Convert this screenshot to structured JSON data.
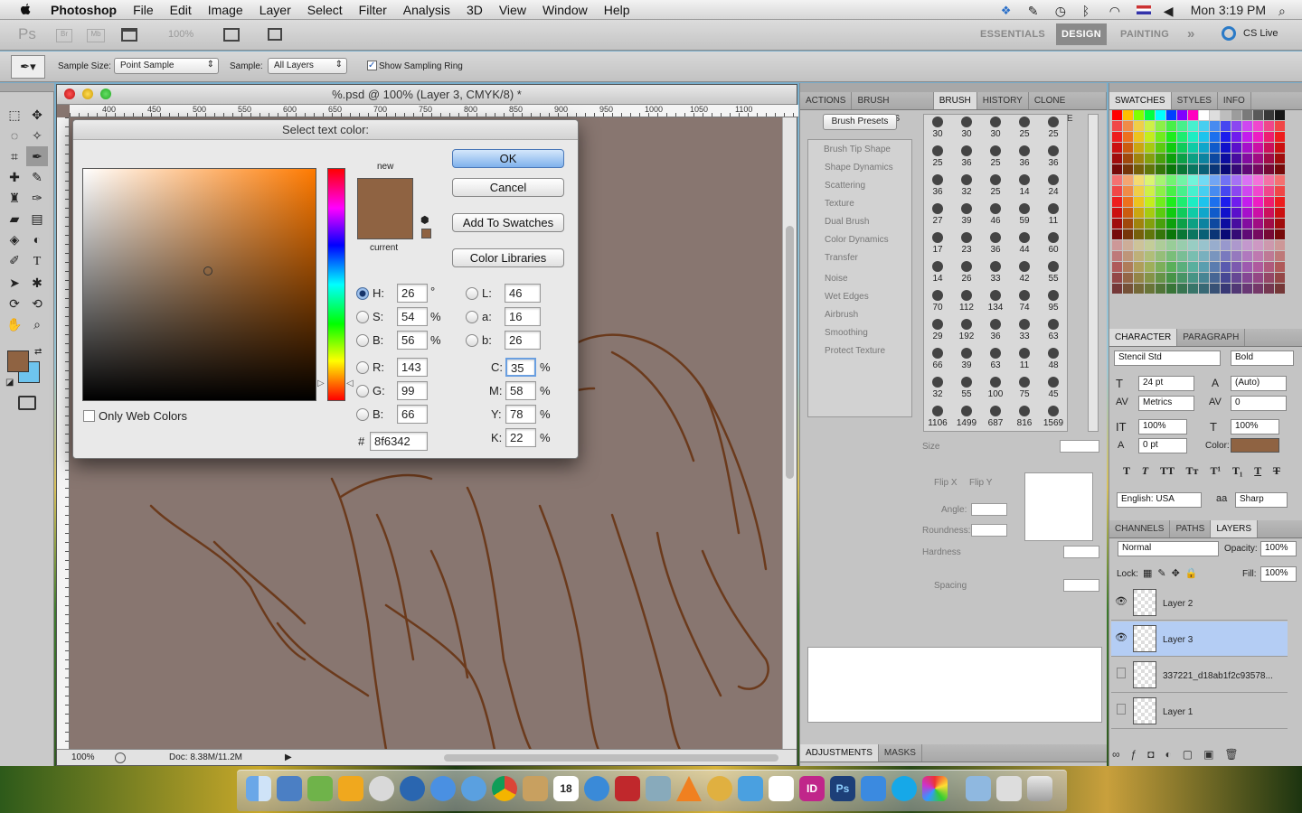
{
  "menubar": {
    "app": "Photoshop",
    "items": [
      "File",
      "Edit",
      "Image",
      "Layer",
      "Select",
      "Filter",
      "Analysis",
      "3D",
      "View",
      "Window",
      "Help"
    ],
    "clock": "Mon 3:19 PM"
  },
  "appbar": {
    "logo": "Ps",
    "br": "Br",
    "mb": "Mb",
    "zoom": "100%",
    "workspaces": [
      "ESSENTIALS",
      "DESIGN",
      "PAINTING"
    ],
    "active_workspace": "DESIGN",
    "more": "»",
    "cslive": "CS Live"
  },
  "options": {
    "sample_size_label": "Sample Size:",
    "sample_size_value": "Point Sample",
    "sample_label": "Sample:",
    "sample_value": "All Layers",
    "ring_label": "Show Sampling Ring",
    "ring_checked": true
  },
  "document": {
    "title": "%.psd @ 100% (Layer 3, CMYK/8) *",
    "ruler_ticks": [
      "400",
      "450",
      "500",
      "550",
      "600",
      "650",
      "700",
      "750",
      "800",
      "850",
      "900",
      "950",
      "1000",
      "1050",
      "1100"
    ],
    "zoom": "100%",
    "doc_size": "Doc: 8.38M/11.2M"
  },
  "color_picker": {
    "title": "Select text color:",
    "new_label": "new",
    "current_label": "current",
    "new_color": "#8f6342",
    "current_color": "#8f6342",
    "buttons": {
      "ok": "OK",
      "cancel": "Cancel",
      "add": "Add To Swatches",
      "libraries": "Color Libraries"
    },
    "hsb": {
      "h": "26",
      "s": "54",
      "b": "56"
    },
    "rgb": {
      "r": "143",
      "g": "99",
      "b": "66"
    },
    "lab": {
      "l": "46",
      "a": "16",
      "b": "26"
    },
    "cmyk": {
      "c": "35",
      "m": "58",
      "y": "78",
      "k": "22"
    },
    "hex": "8f6342",
    "labels": {
      "h": "H:",
      "s": "S:",
      "bb": "B:",
      "r": "R:",
      "g": "G:",
      "b": "B:",
      "l": "L:",
      "a": "a:",
      "lb": "b:",
      "c": "C:",
      "m": "M:",
      "y": "Y:",
      "k": "K:",
      "hash": "#"
    },
    "units": {
      "deg": "°",
      "pct": "%"
    },
    "only_web": "Only Web Colors",
    "field_color_hue": "#ff7a00"
  },
  "brush_panel": {
    "tabs": [
      "ACTIONS",
      "BRUSH PRESETS",
      "BRUSH",
      "HISTORY",
      "CLONE SOURCE"
    ],
    "active_tab": "BRUSH",
    "presets_button": "Brush Presets",
    "options": [
      "Brush Tip Shape",
      "Shape Dynamics",
      "Scattering",
      "Texture",
      "Dual Brush",
      "Color Dynamics",
      "Transfer",
      "Noise",
      "Wet Edges",
      "Airbrush",
      "Smoothing",
      "Protect Texture"
    ],
    "sizes": [
      "30",
      "30",
      "30",
      "25",
      "25",
      "25",
      "36",
      "25",
      "36",
      "36",
      "36",
      "32",
      "25",
      "14",
      "24",
      "27",
      "39",
      "46",
      "59",
      "11",
      "17",
      "23",
      "36",
      "44",
      "60",
      "14",
      "26",
      "33",
      "42",
      "55",
      "70",
      "112",
      "134",
      "74",
      "95",
      "29",
      "192",
      "36",
      "33",
      "63",
      "66",
      "39",
      "63",
      "11",
      "48",
      "32",
      "55",
      "100",
      "75",
      "45",
      "1106",
      "1499",
      "687",
      "816",
      "1569"
    ],
    "size_label": "Size",
    "flipx": "Flip X",
    "flipy": "Flip Y",
    "angle": "Angle:",
    "roundness": "Roundness:",
    "hardness": "Hardness",
    "spacing": "Spacing"
  },
  "adjust_tabs": [
    "ADJUSTMENTS",
    "MASKS"
  ],
  "swatches_tabs": [
    "SWATCHES",
    "STYLES",
    "INFO"
  ],
  "character": {
    "tabs": [
      "CHARACTER",
      "PARAGRAPH"
    ],
    "font": "Stencil Std",
    "style": "Bold",
    "size": "24 pt",
    "leading": "(Auto)",
    "kerning": "Metrics",
    "tracking": "0",
    "vscale": "100%",
    "hscale": "100%",
    "baseline": "0 pt",
    "color_label": "Color:",
    "color": "#8f6342",
    "language": "English: USA",
    "aa_icon": "aa",
    "antialias": "Sharp"
  },
  "layers": {
    "tabs": [
      "CHANNELS",
      "PATHS",
      "LAYERS"
    ],
    "blend": "Normal",
    "opacity_label": "Opacity:",
    "opacity": "100%",
    "lock_label": "Lock:",
    "fill_label": "Fill:",
    "fill": "100%",
    "items": [
      "Layer 2",
      "Layer 3",
      "337221_d18ab1f2c93578...",
      "Layer 1"
    ],
    "selected": "Layer 3"
  },
  "dock": {
    "apps": [
      "finder",
      "launchpad",
      "pages",
      "files",
      "ical",
      "itunes",
      "photos",
      "id",
      "ps",
      "skype",
      "folder"
    ],
    "id_label": "ID",
    "ps_label": "Ps",
    "cal_day": "18"
  }
}
